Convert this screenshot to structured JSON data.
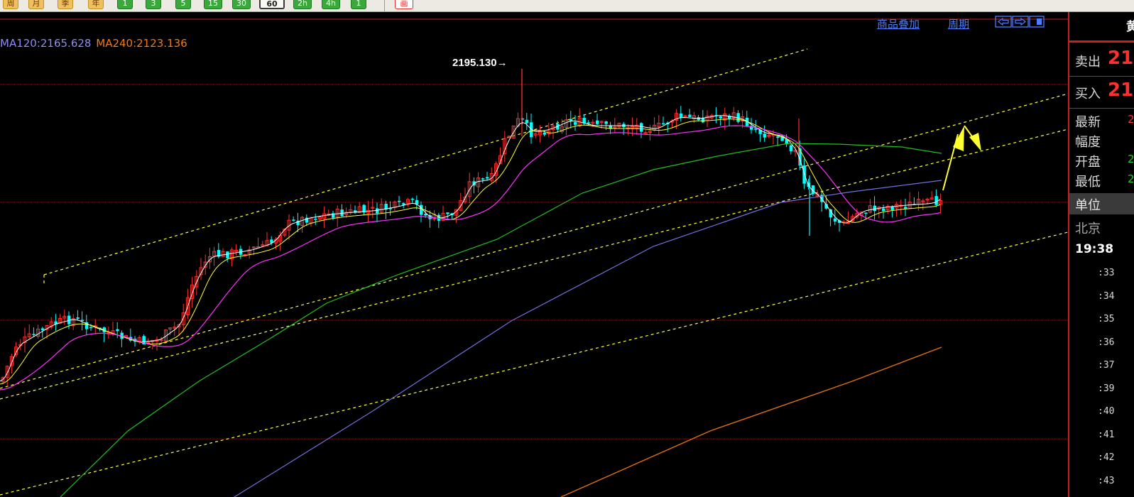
{
  "toolbar": {
    "buttons": [
      "周",
      "月",
      "季",
      "年",
      "1",
      "3",
      "5",
      "15",
      "30",
      "60",
      "2h",
      "4h",
      "1"
    ],
    "active_index": 9,
    "draw_label": "画"
  },
  "chart_header": {
    "ma120_label": "MA120:2165.628",
    "ma240_label": "MA240:2123.136",
    "overlay_link": "商品叠加",
    "period_link": "周期",
    "nav_icons": [
      "◫",
      "◫",
      "▣"
    ]
  },
  "annotation": {
    "high_price": "2195.130"
  },
  "colors": {
    "candle_up": "#ff3030",
    "candle_down": "#00ffff",
    "ma_short": "#ffffff",
    "ma_mid": "#ffff30",
    "ma_long": "#ff30ff",
    "ma60": "#20c020",
    "ma120": "#7070e0",
    "ma240": "#e07010",
    "channel": "#ffff40",
    "arrow": "#ffff30",
    "grid": "#8a1818"
  },
  "quote_panel": {
    "title_partial": "黄",
    "sell_label": "卖出",
    "sell_value": "21",
    "buy_label": "买入",
    "buy_value": "21",
    "latest_label": "最新",
    "latest_value": "2",
    "amplitude_label": "幅度",
    "open_label": "开盘",
    "open_value": "2",
    "low_label": "最低",
    "low_value": "2",
    "unit_label": "单位",
    "location": "北京",
    "time": "19:38",
    "ticks": [
      ":33",
      ":34",
      ":35",
      ":36",
      ":37",
      ":39",
      ":40",
      ":41",
      ":42",
      ":43"
    ]
  }
}
